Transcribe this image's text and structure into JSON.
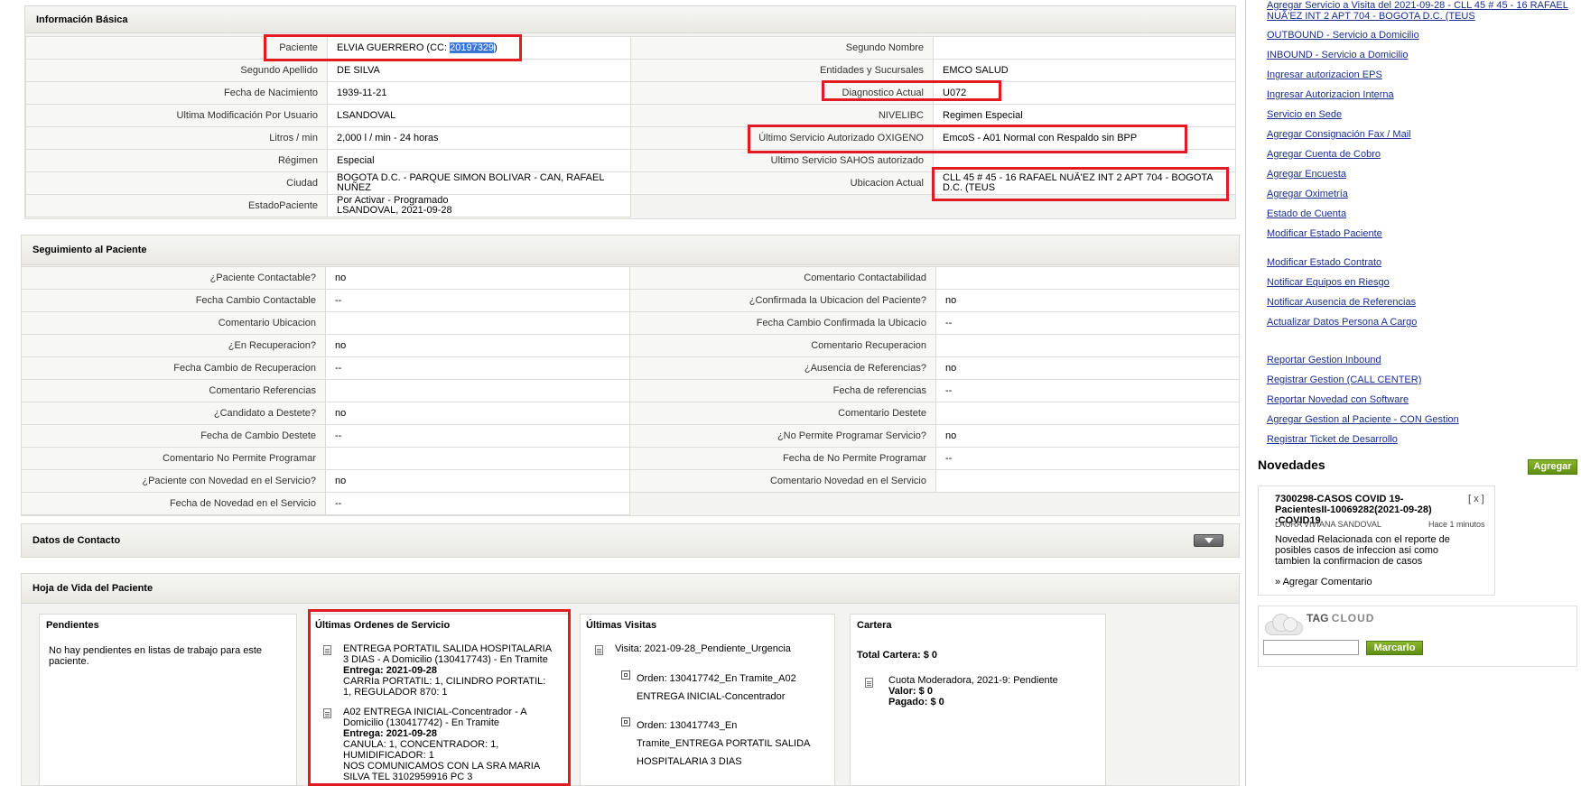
{
  "basic_info": {
    "title": "Información Básica",
    "left_rows": [
      {
        "label": "Paciente",
        "value_prefix": "ELVIA GUERRERO (CC: ",
        "value_id": "20197329",
        "value_suffix": ")"
      },
      {
        "label": "Segundo Apellido",
        "value": "DE SILVA"
      },
      {
        "label": "Fecha de Nacimiento",
        "value": "1939-11-21"
      },
      {
        "label": "Ultima Modificación Por Usuario",
        "value": "LSANDOVAL"
      },
      {
        "label": "Litros / min",
        "value": "2,000 l / min - 24 horas"
      },
      {
        "label": "Régimen",
        "value": "Especial"
      },
      {
        "label": "Ciudad",
        "value": "BOGOTA D.C. - PARQUE SIMON BOLIVAR - CAN, RAFAEL NUÑEZ"
      },
      {
        "label": "EstadoPaciente",
        "value": "Por Activar - Programado",
        "value2": "LSANDOVAL, 2021-09-28"
      }
    ],
    "right_rows": [
      {
        "label": "Segundo Nombre",
        "value": ""
      },
      {
        "label": "Entidades y Sucursales",
        "value": "EMCO SALUD"
      },
      {
        "label": "Diagnostico Actual",
        "value": "U072"
      },
      {
        "label": "NIVELIBC",
        "value": "Regimen Especial"
      },
      {
        "label": "Último Servicio Autorizado OXIGENO",
        "value": "EmcoS - A01 Normal con Respaldo sin BPP"
      },
      {
        "label": "Ultimo Servicio SAHOS autorizado",
        "value": ""
      },
      {
        "label": "Ubicacion Actual",
        "value": "CLL 45 # 45 - 16 RAFAEL NUÃ'EZ INT 2 APT 704 - BOGOTA D.C. (TEUS"
      }
    ]
  },
  "seguimiento": {
    "title": "Seguimiento al Paciente",
    "left_rows": [
      {
        "label": "¿Paciente Contactable?",
        "value": "no"
      },
      {
        "label": "Fecha Cambio Contactable",
        "value": "--"
      },
      {
        "label": "Comentario Ubicacion",
        "value": ""
      },
      {
        "label": "¿En Recuperacion?",
        "value": "no"
      },
      {
        "label": "Fecha Cambio de Recuperacion",
        "value": "--"
      },
      {
        "label": "Comentario Referencias",
        "value": ""
      },
      {
        "label": "¿Candidato a Destete?",
        "value": "no"
      },
      {
        "label": "Fecha de Cambio Destete",
        "value": "--"
      },
      {
        "label": "Comentario No Permite Programar",
        "value": ""
      },
      {
        "label": "¿Paciente con Novedad en el Servicio?",
        "value": "no"
      },
      {
        "label": "Fecha de Novedad en el Servicio",
        "value": "--"
      }
    ],
    "right_rows": [
      {
        "label": "Comentario Contactabilidad",
        "value": ""
      },
      {
        "label": "¿Confirmada la Ubicacion del Paciente?",
        "value": "no"
      },
      {
        "label": "Fecha Cambio Confirmada la Ubicacio",
        "value": "--"
      },
      {
        "label": "Comentario Recuperacion",
        "value": ""
      },
      {
        "label": "¿Ausencia de Referencias?",
        "value": "no"
      },
      {
        "label": "Fecha de referencias",
        "value": "--"
      },
      {
        "label": "Comentario Destete",
        "value": ""
      },
      {
        "label": "¿No Permite Programar Servicio?",
        "value": "no"
      },
      {
        "label": "Fecha de No Permite Programar",
        "value": "--"
      },
      {
        "label": "Comentario Novedad en el Servicio",
        "value": ""
      }
    ]
  },
  "contacto": {
    "title": "Datos de Contacto"
  },
  "hoja_vida": {
    "title": "Hoja de Vida del Paciente",
    "pendientes": {
      "title": "Pendientes",
      "text": "No hay pendientes en listas de trabajo para este paciente."
    },
    "ordenes": {
      "title": "Últimas Ordenes de Servicio",
      "items": [
        {
          "line1": "ENTREGA PORTATIL SALIDA HOSPITALARIA",
          "line2": "3 DIAS - A Domicilio (130417743) - En Tramite",
          "entrega_label": "Entrega:",
          "entrega": "2021-09-28",
          "line4": "CARRIa PORTATIL: 1, CILINDRO PORTATIL:",
          "line5": "1, REGULADOR 870: 1"
        },
        {
          "line1": "A02 ENTREGA INICIAL-Concentrador - A",
          "line2": "Domicilio (130417742) - En Tramite",
          "entrega_label": "Entrega:",
          "entrega": "2021-09-28",
          "line4": "CANULA: 1, CONCENTRADOR: 1,",
          "line5": "HUMIDIFICADOR: 1",
          "line6": "NOS COMUNICAMOS CON LA SRA MARIA",
          "line7": "SILVA TEL 3102959916 PC 3"
        }
      ]
    },
    "visitas": {
      "title": "Últimas Visitas",
      "visita": "Visita: 2021-09-28_Pendiente_Urgencia",
      "orden1_a": "Orden: 130417742_En Tramite_A02",
      "orden1_b": "ENTREGA INICIAL-Concentrador",
      "orden2_a": "Orden: 130417743_En",
      "orden2_b": "Tramite_ENTREGA PORTATIL SALIDA",
      "orden2_c": "HOSPITALARIA 3 DIAS"
    },
    "cartera": {
      "title": "Cartera",
      "total": "Total Cartera: $ 0",
      "cuota": "Cuota Moderadora, 2021-9: Pendiente",
      "valor_label": "Valor:",
      "valor": "$ 0",
      "pagado_label": "Pagado:",
      "pagado": "$ 0"
    }
  },
  "right_links": {
    "top_line1": "Agregar Servicio a Visita del 2021-09-28 - CLL 45 # 45 - 16 RAFAEL",
    "top_line2": "NUÃ'EZ INT 2 APT 704 - BOGOTA D.C. (TEUS",
    "group1": [
      "OUTBOUND - Servicio a Domicilio",
      "INBOUND - Servicio a Domicilio",
      "Ingresar autorizacion EPS",
      "Ingresar Autorizacion Interna",
      "Servicio en Sede",
      "Agregar Consignación Fax / Mail",
      "Agregar Cuenta de Cobro",
      "Agregar Encuesta",
      "Agregar Oximetría",
      "Estado de Cuenta",
      "Modificar Estado Paciente"
    ],
    "group2": [
      "Modificar Estado Contrato",
      "Notificar Equipos en Riesgo",
      "Notificar Ausencia de Referencias",
      "Actualizar Datos Persona A Cargo"
    ],
    "group3": [
      "Reportar Gestion Inbound",
      "Registrar Gestion (CALL CENTER)",
      "Reportar Novedad con Software",
      "Agregar Gestion al Paciente - CON Gestion",
      "Registrar Ticket de Desarrollo"
    ]
  },
  "novedades": {
    "title": "Novedades",
    "add_button": "Agregar",
    "card_title": "7300298-CASOS COVID 19-PacientesII-10069282(2021-09-28) :COVID19",
    "close": "[ x ]",
    "author": "LAURA VIVIANA SANDOVAL",
    "time": "Hace 1 minutos",
    "body": "Novedad Relacionada con el reporte de posibles casos de infeccion asi como tambien la confirmacion de casos",
    "comment_link": "» Agregar Comentario"
  },
  "tag_cloud": {
    "title_tag": "TAG",
    "title_cloud": "CLOUD",
    "input_value": "",
    "button": "Marcarlo"
  }
}
